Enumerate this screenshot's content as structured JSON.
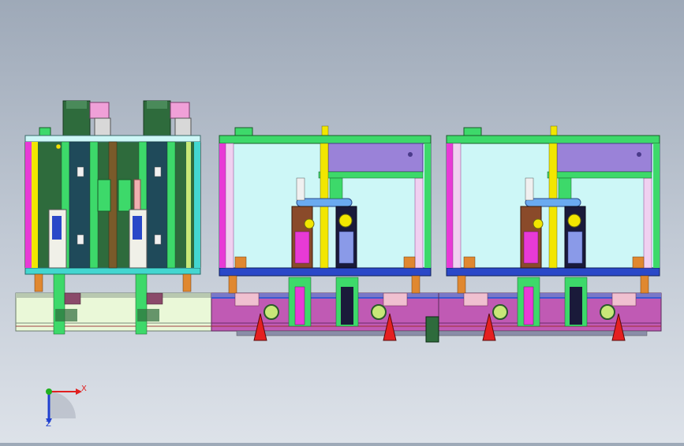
{
  "viewport": {
    "background_top": "#9ea9b8",
    "background_bottom": "#dde2e9"
  },
  "triad": {
    "x_label": "X",
    "z_label": "Z",
    "x_color": "#e02020",
    "y_color": "#20b020",
    "z_color": "#2040d0"
  },
  "colors": {
    "frame_cyan": "#43d6d0",
    "frame_green": "#3dd96a",
    "panel_dark_green": "#2e6b3c",
    "panel_light_cyan": "#cdf7f7",
    "panel_purple": "#9a82d8",
    "rail_magenta": "#c05ab4",
    "rail_light": "#eaf8d8",
    "accent_yellow": "#f2e600",
    "accent_magenta": "#e83ad6",
    "accent_orange": "#e08830",
    "accent_red": "#e52020",
    "accent_blue": "#2a48c8"
  },
  "model": {
    "stations": [
      {
        "id": "station-1",
        "kind": "stacker"
      },
      {
        "id": "station-2",
        "kind": "press"
      },
      {
        "id": "station-3",
        "kind": "press"
      }
    ]
  }
}
